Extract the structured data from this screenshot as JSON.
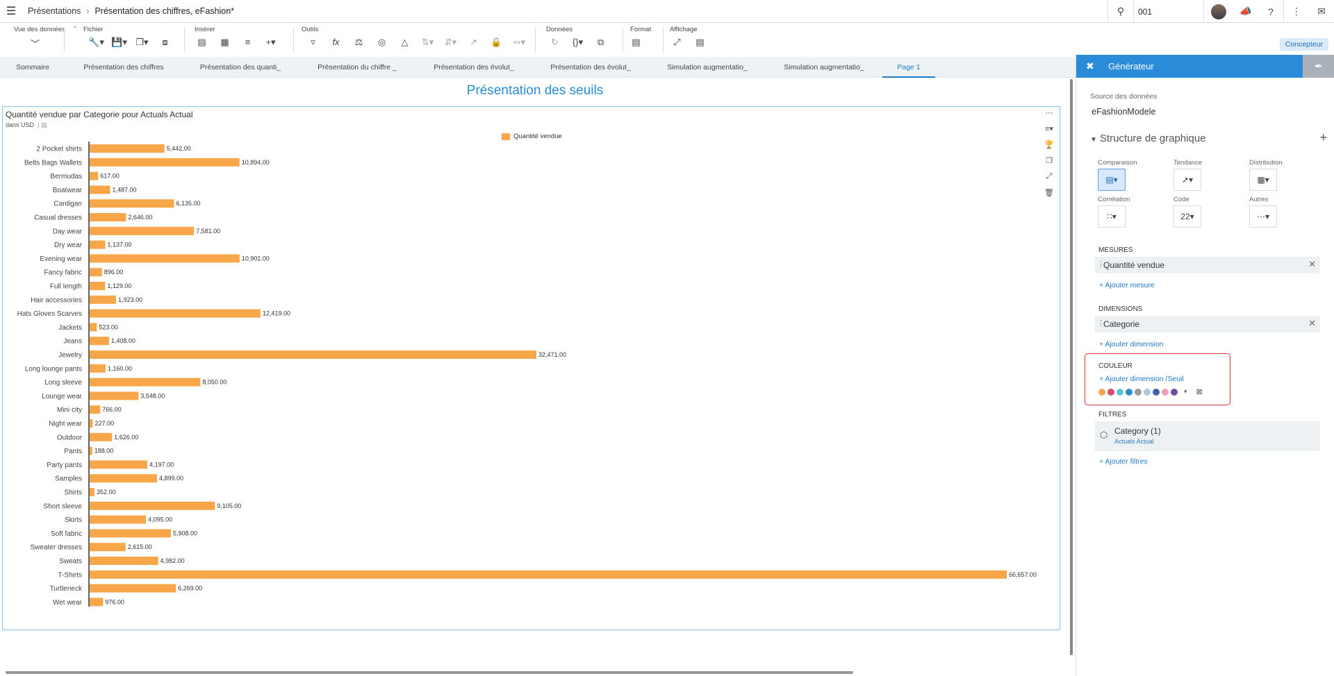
{
  "shell": {
    "breadcrumb_root": "Présentations",
    "breadcrumb_sep": "›",
    "breadcrumb_current": "Présentation des chiffres, eFashion*",
    "tenant": "001"
  },
  "toolbar": {
    "groups": [
      "Vue des données",
      "Fichier",
      "Insérer",
      "Outils",
      "Données",
      "Format",
      "Affichage"
    ],
    "designer_label": "Concepteur"
  },
  "tabs": [
    "Sommaire",
    "Présentation des chiffres",
    "Présentation des quanti_",
    "Présentation du chiffre _",
    "Présentation des évolut_",
    "Présentation des évolut_",
    "Simulation augmentatio_",
    "Simulation augmentatio_",
    "Page 1"
  ],
  "page": {
    "title": "Présentation des seuils"
  },
  "chart": {
    "title": "Quantité vendue par Categorie pour Actuals Actual",
    "subtitle": "dans USD",
    "legend": "Quantité vendue",
    "color": "#f8a64a"
  },
  "chart_data": {
    "type": "bar",
    "orientation": "horizontal",
    "title": "Quantité vendue par Categorie pour Actuals Actual",
    "subtitle": "dans USD",
    "legend": [
      "Quantité vendue"
    ],
    "categories": [
      "2 Pocket shirts",
      "Belts Bags Wallets",
      "Bermudas",
      "Boatwear",
      "Cardigan",
      "Casual dresses",
      "Day wear",
      "Dry wear",
      "Evening wear",
      "Fancy fabric",
      "Full length",
      "Hair accessories",
      "Hats Gloves Scarves",
      "Jackets",
      "Jeans",
      "Jewelry",
      "Long lounge pants",
      "Long sleeve",
      "Lounge wear",
      "Mini city",
      "Night wear",
      "Outdoor",
      "Pants",
      "Party pants",
      "Samples",
      "Shirts",
      "Short sleeve",
      "Skirts",
      "Soft fabric",
      "Sweater dresses",
      "Sweats",
      "T-Shirts",
      "Turtleneck",
      "Wet wear"
    ],
    "values": [
      5442,
      10894,
      617,
      1487,
      6135,
      2646,
      7581,
      1137,
      10901,
      896,
      1129,
      1923,
      12419,
      523,
      1408,
      32471,
      1160,
      8050,
      3548,
      766,
      227,
      1626,
      188,
      4197,
      4899,
      352,
      9105,
      4095,
      5908,
      2615,
      4982,
      66657,
      6269,
      976
    ],
    "labels": [
      "5,442.00",
      "10,894.00",
      "617.00",
      "1,487.00",
      "6,135.00",
      "2,646.00",
      "7,581.00",
      "1,137.00",
      "10,901.00",
      "896.00",
      "1,129.00",
      "1,923.00",
      "12,419.00",
      "523.00",
      "1,408.00",
      "32,471.00",
      "1,160.00",
      "8,050.00",
      "3,548.00",
      "766.00",
      "227.00",
      "1,626.00",
      "188.00",
      "4,197.00",
      "4,899.00",
      "352.00",
      "9,105.00",
      "4,095.00",
      "5,908.00",
      "2,615.00",
      "4,982.00",
      "66,657.00",
      "6,269.00",
      "976.00"
    ],
    "xlim": [
      0,
      66657
    ]
  },
  "panel": {
    "title": "Générateur",
    "source_label": "Source des données",
    "source_value": "eFashionModele",
    "structure_label": "Structure de graphique",
    "types": [
      {
        "label": "Comparaison",
        "icon": "bar-chart-icon"
      },
      {
        "label": "Tendance",
        "icon": "line-chart-icon"
      },
      {
        "label": "Distribution",
        "icon": "grid-table-icon"
      },
      {
        "label": "Corrélation",
        "icon": "scatter-icon"
      },
      {
        "label": "Code",
        "icon": "numeric-point-icon",
        "glyph": "22"
      },
      {
        "label": "Autres",
        "icon": "more-icon"
      }
    ],
    "measures_label": "MESURES",
    "measure": "Quantité vendue",
    "add_measure": "+ Ajouter mesure",
    "dimensions_label": "DIMENSIONS",
    "dimension": "Categorie",
    "add_dimension": "+ Ajouter dimension",
    "color_label": "COULEUR",
    "add_color": "+ Ajouter dimension /Seuil",
    "palette": [
      "#f8a64a",
      "#e0457b",
      "#5fc4d1",
      "#2d8fc9",
      "#9b9b9b",
      "#a7c7e7",
      "#3d5ea8",
      "#ef9fb5",
      "#6a4fa3"
    ],
    "filters_label": "FILTRES",
    "filter_name": "Category (1)",
    "filter_value": "Actuals Actual",
    "add_filter": "+ Ajouter filtres"
  }
}
